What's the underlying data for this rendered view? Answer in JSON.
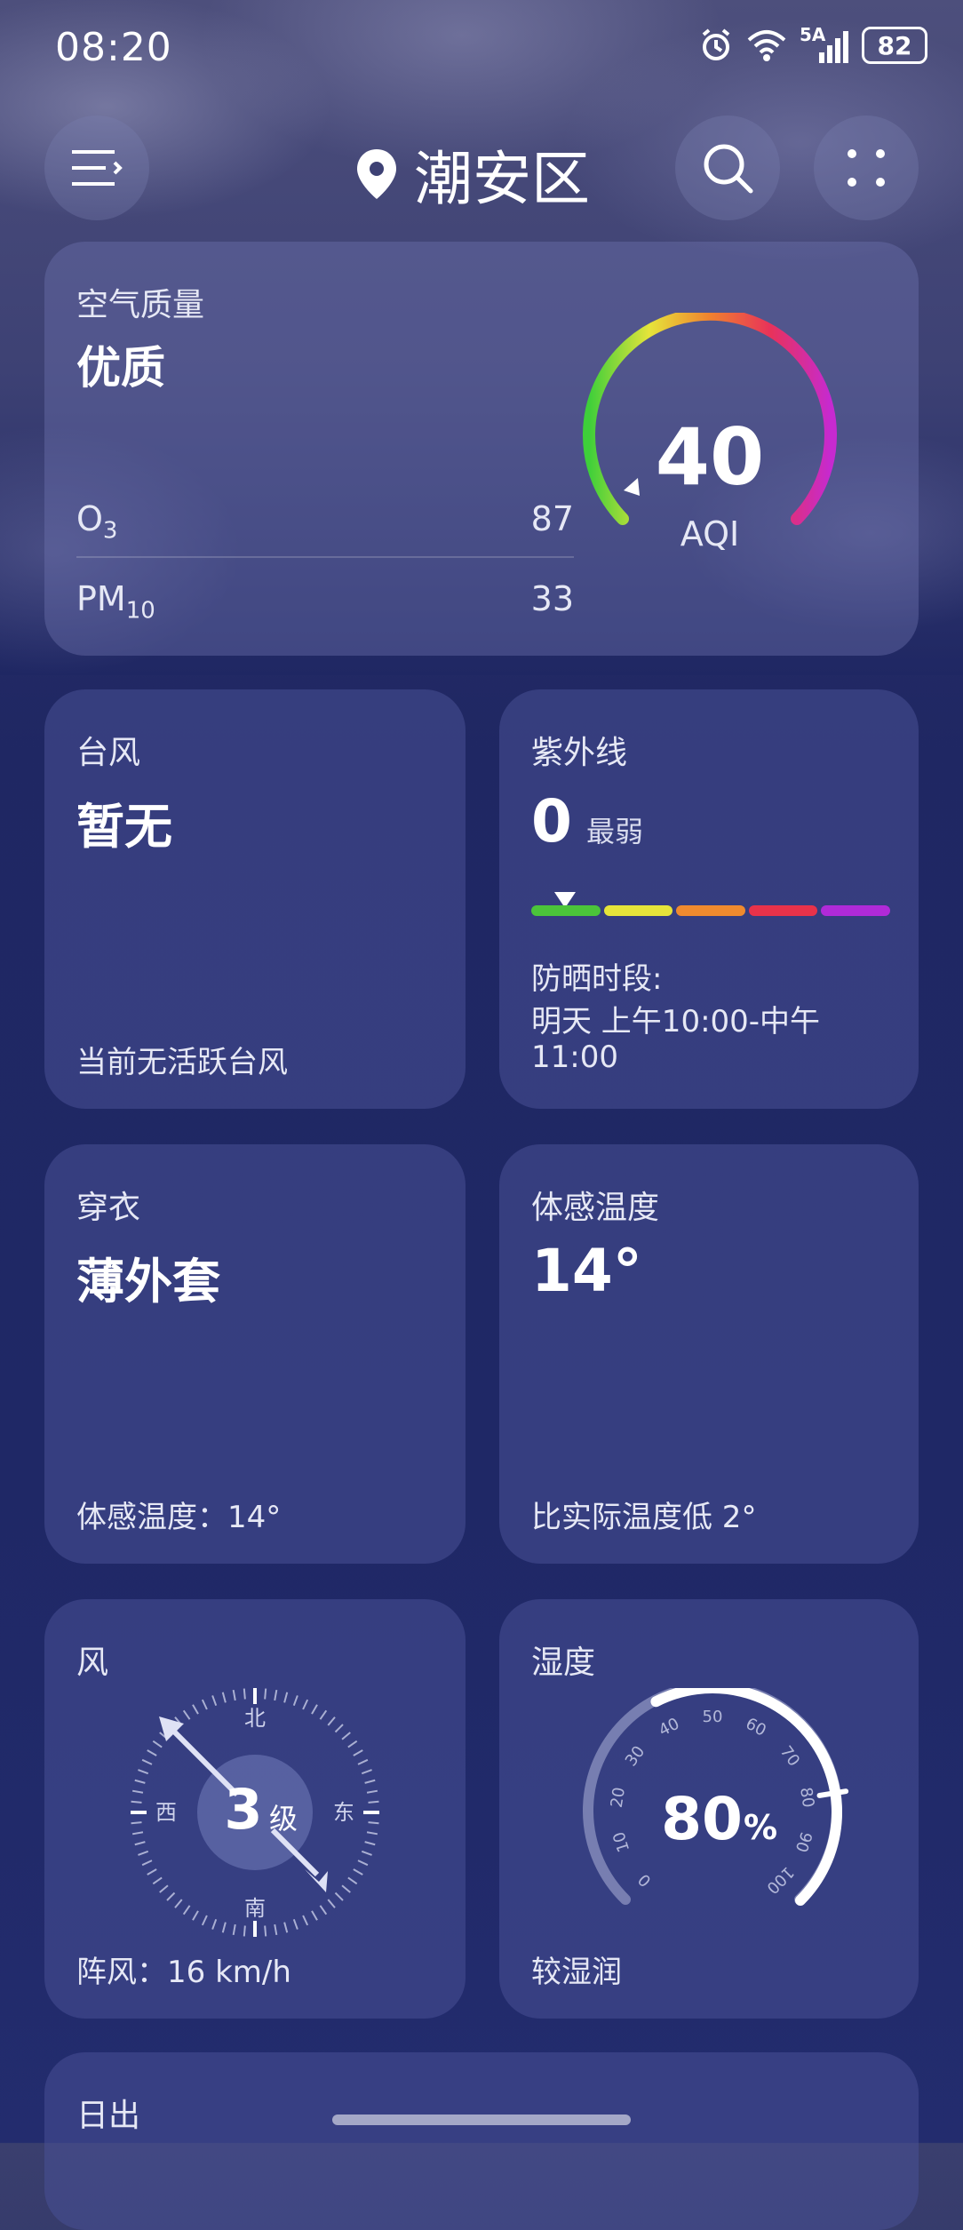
{
  "status_bar": {
    "time": "08:20",
    "network": "5A",
    "battery": "82"
  },
  "header": {
    "city": "潮安区",
    "icons": [
      "menu-icon",
      "location-pin-icon",
      "search-icon",
      "more-grid-icon"
    ]
  },
  "air_quality": {
    "title": "空气质量",
    "level": "优质",
    "aqi_value": "40",
    "aqi_label": "AQI",
    "aqi_fraction": 0.08,
    "o3_label": "O",
    "o3_sub": "3",
    "o3_value": "87",
    "pm_label": "PM",
    "pm_sub": "10",
    "pm_value": "33"
  },
  "typhoon": {
    "title": "台风",
    "value": "暂无",
    "note": "当前无活跃台风"
  },
  "uv": {
    "title": "紫外线",
    "value": "0",
    "level": "最弱",
    "bar_colors": [
      "#4bc43a",
      "#e6e43a",
      "#f08a2e",
      "#e8324a",
      "#b02ad8"
    ],
    "sunscreen_label": "防晒时段:",
    "sunscreen_time_1": "明天 上午10:00-中午",
    "sunscreen_time_2": "11:00"
  },
  "clothing": {
    "title": "穿衣",
    "value": "薄外套",
    "note": "体感温度：14°"
  },
  "feels_like": {
    "title": "体感温度",
    "value": "14°",
    "note": "比实际温度低 2°"
  },
  "wind": {
    "title": "风",
    "level": "3",
    "level_unit": "级",
    "north": "北",
    "south": "南",
    "east": "东",
    "west": "西",
    "gust": "阵风：16 km/h"
  },
  "humidity": {
    "title": "湿度",
    "value": "80",
    "unit": "%",
    "ticks": [
      "0",
      "10",
      "20",
      "30",
      "40",
      "50",
      "60",
      "70",
      "80",
      "90",
      "100"
    ],
    "note": "较湿润"
  },
  "sunrise": {
    "title": "日出"
  }
}
